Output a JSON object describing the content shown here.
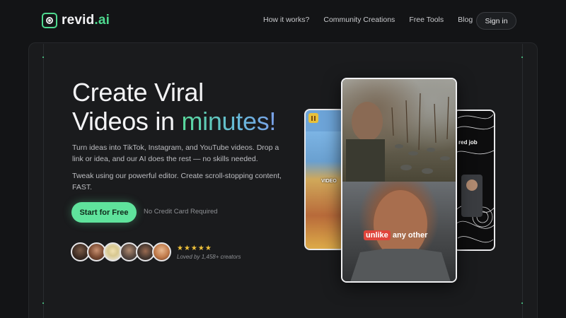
{
  "brand": {
    "name_main": "revid",
    "name_suffix": ".ai",
    "accent": "#4ed98f"
  },
  "nav": {
    "links": [
      "How it works?",
      "Community Creations",
      "Free Tools",
      "Blog"
    ],
    "signin": "Sign in"
  },
  "hero": {
    "headline_line1": "Create Viral",
    "headline_line2_prefix": "Videos in ",
    "headline_highlight": "minutes!",
    "para1": "Turn ideas into TikTok, Instagram, and YouTube videos. Drop a link or idea, and our AI does the rest — no skills needed.",
    "para2": "Tweak using our powerful editor. Create scroll-stopping content, FAST.",
    "cta": "Start for Free",
    "cta_note": "No Credit Card Required",
    "stars": "★★★★★",
    "rating": 5,
    "loved": "Loved by 1,458+ creators",
    "avatars": [
      "avatar-1",
      "avatar-2",
      "avatar-3",
      "avatar-4",
      "avatar-5",
      "avatar-6"
    ]
  },
  "cards": {
    "main_caption_highlight": "unlike",
    "main_caption_rest": " any other",
    "left_caption": "VIDEO",
    "right_caption": "red job"
  },
  "colors": {
    "background": "#131416",
    "panel": "#1a1b1d",
    "cta": "#5fe39c",
    "star": "#f0c23a"
  }
}
